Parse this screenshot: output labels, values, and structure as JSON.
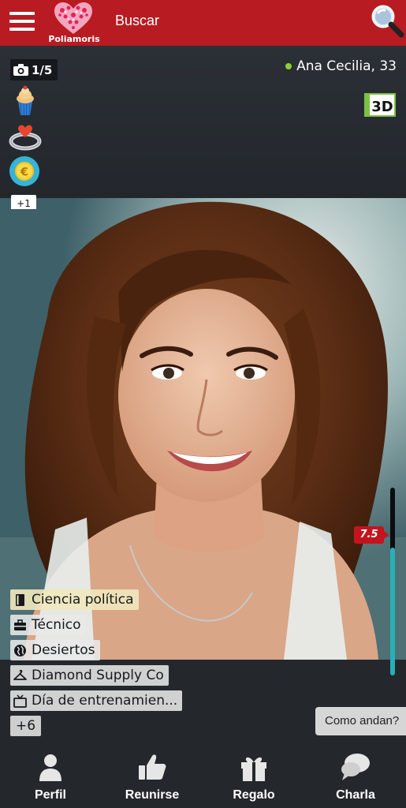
{
  "topbar": {
    "logo_text": "Poliamoris",
    "search_label": "Buscar",
    "accent_color": "#b81b22"
  },
  "profile": {
    "photo_counter": "1/5",
    "name": "Ana Cecilia, 33",
    "online": true,
    "badge_3d": "3D",
    "more_badges": "+1",
    "badges": [
      "cupcake-icon",
      "ring-icon",
      "coin-icon"
    ]
  },
  "tags": [
    {
      "label": "Ciencia política",
      "icon": "book-icon"
    },
    {
      "label": "Técnico",
      "icon": "briefcase-icon"
    },
    {
      "label": "Desiertos",
      "icon": "globe-icon"
    },
    {
      "label": "Diamond Supply Co",
      "icon": "hanger-icon"
    },
    {
      "label": "Día de entrenamien...",
      "icon": "tv-icon"
    }
  ],
  "tags_more": "+6",
  "rating": {
    "value": "7.5",
    "fill_fraction": 0.68
  },
  "quick_message": "Como andan?",
  "bottom_nav": [
    {
      "label": "Perfil",
      "icon": "person-icon"
    },
    {
      "label": "Reunirse",
      "icon": "thumbs-up-icon"
    },
    {
      "label": "Regalo",
      "icon": "gift-icon"
    },
    {
      "label": "Charla",
      "icon": "chat-bubble-icon"
    }
  ]
}
